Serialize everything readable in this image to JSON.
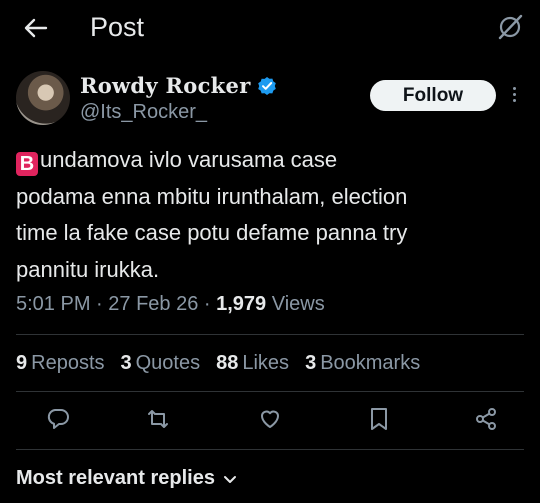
{
  "header": {
    "title": "Post",
    "back_icon": "arrow-left-icon",
    "grok_icon": "grok-icon"
  },
  "author": {
    "display_name": "Rowdy Rocker",
    "handle": "@Its_Rocker_",
    "verified": true,
    "verified_color": "#1d9bf0",
    "follow_label": "Follow"
  },
  "tweet": {
    "badge": "B",
    "lines": [
      "undamova ivlo varusama case",
      "podama enna mbitu irunthalam, election",
      "time la fake case potu defame panna try",
      "pannitu irukka."
    ]
  },
  "meta": {
    "time": "5:01 PM",
    "date": "27 Feb 26",
    "views_count": "1,979",
    "views_label": "Views"
  },
  "stats": {
    "reposts_count": "9",
    "reposts_label": "Reposts",
    "quotes_count": "3",
    "quotes_label": "Quotes",
    "likes_count": "88",
    "likes_label": "Likes",
    "bookmarks_count": "3",
    "bookmarks_label": "Bookmarks"
  },
  "replies_sort": {
    "label": "Most relevant replies"
  },
  "colors": {
    "background": "#000000",
    "text": "#e7e9ea",
    "muted": "#8b98a5",
    "divider": "#2f3336",
    "badge": "#e0245e"
  }
}
